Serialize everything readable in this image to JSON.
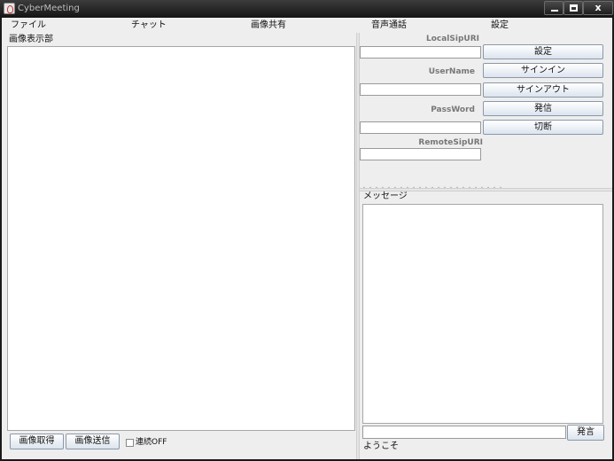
{
  "window": {
    "title": "CyberMeeting"
  },
  "titlebar": {
    "close_glyph": "x"
  },
  "menubar": [
    "ファイル",
    "チャット",
    "画像共有",
    "音声通話",
    "設定"
  ],
  "image_panel": {
    "label": "画像表示部",
    "get_button": "画像取得",
    "send_button": "画像送信",
    "continuous_checkbox": {
      "label": "連続OFF",
      "checked": false
    }
  },
  "sip_panel": {
    "local_sip_uri_label": "LocalSipURI",
    "local_sip_uri_value": "",
    "settings_button": "設定",
    "username_label": "UserName",
    "username_value": "",
    "signin_button": "サインイン",
    "signout_button": "サインアウト",
    "password_label": "PassWord",
    "password_value": "",
    "call_button": "発信",
    "hangup_button": "切断",
    "remote_sip_uri_label": "RemoteSipURI",
    "remote_sip_uri_value": ""
  },
  "message_panel": {
    "label": "メッセージ",
    "input_value": "",
    "send_button": "発言",
    "status_text": "ようこそ"
  },
  "icons": [
    "app-icon",
    "minimize-icon",
    "maximize-icon",
    "close-icon",
    "checkbox-icon"
  ],
  "colors": {
    "titlebar": "#1e1e1e",
    "panel_bg": "#eeeeee",
    "button_bottom": "#dce4ee"
  }
}
